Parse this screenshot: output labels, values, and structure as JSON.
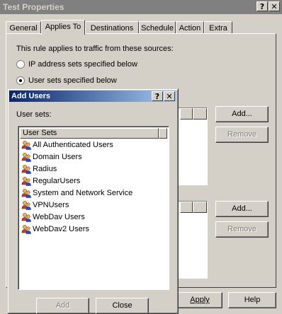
{
  "outer_dialog": {
    "title": "Test Properties",
    "help_btn": "?",
    "close_btn": "✕",
    "tabs": [
      {
        "label": "General"
      },
      {
        "label": "Applies To"
      },
      {
        "label": "Destinations"
      },
      {
        "label": "Schedule"
      },
      {
        "label": "Action"
      },
      {
        "label": "Extra"
      }
    ],
    "intro": "This rule applies to traffic from these sources:",
    "radio_ip": "IP address sets specified below",
    "radio_user": "User sets specified below",
    "add_top": "Add...",
    "remove_top": "Remove",
    "add_bottom": "Add...",
    "remove_bottom": "Remove",
    "apply_label": "Apply",
    "help_label": "Help"
  },
  "add_users_dialog": {
    "title": "Add Users",
    "help_btn": "?",
    "close_btn": "✕",
    "user_sets_label": "User sets:",
    "column_header": "User Sets",
    "items": [
      {
        "label": "All Authenticated Users"
      },
      {
        "label": "Domain Users"
      },
      {
        "label": "Radius"
      },
      {
        "label": "RegularUsers"
      },
      {
        "label": "System and Network Service"
      },
      {
        "label": "VPNUsers"
      },
      {
        "label": "WebDav Users"
      },
      {
        "label": "WebDav2 Users"
      }
    ],
    "add_label": "Add",
    "close_label": "Close"
  },
  "colors": {
    "dialog_bg": "#d4d0c8",
    "active_title": "#0a246a",
    "inactive_title": "#808080"
  },
  "icons": {
    "user_set": "users-group-icon"
  }
}
